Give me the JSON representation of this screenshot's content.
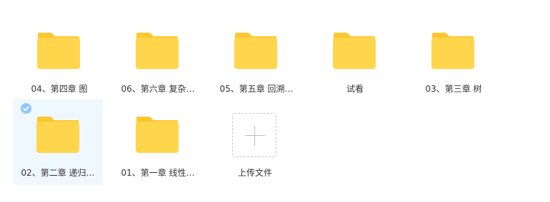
{
  "items": [
    {
      "label": "04、第四章 图",
      "selected": false
    },
    {
      "label": "06、第六章 复杂…",
      "selected": false
    },
    {
      "label": "05、第五章 回溯…",
      "selected": false
    },
    {
      "label": "试看",
      "selected": false
    },
    {
      "label": "03、第三章 树",
      "selected": false
    },
    {
      "label": "02、第二章 递归…",
      "selected": true
    },
    {
      "label": "01、第一章 线性…",
      "selected": false
    }
  ],
  "upload": {
    "label": "上传文件",
    "icon": "plus-icon"
  },
  "icons": {
    "folder": "folder-icon",
    "selected": "check-circle-icon"
  },
  "colors": {
    "folder_body": "#ffd54c",
    "folder_tab": "#ffc62e",
    "selected_bg": "#f0f8ff",
    "check_badge": "#8fc6ff",
    "label_text": "#333333"
  }
}
